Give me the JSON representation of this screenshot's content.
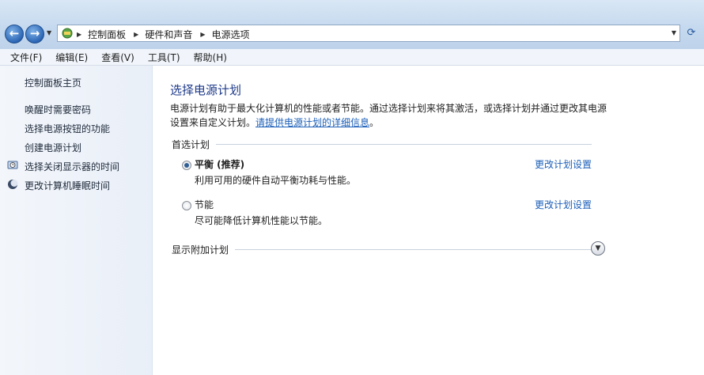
{
  "address": {
    "breadcrumbs": [
      "控制面板",
      "硬件和声音",
      "电源选项"
    ]
  },
  "menu": [
    "文件(F)",
    "编辑(E)",
    "查看(V)",
    "工具(T)",
    "帮助(H)"
  ],
  "sidebar": {
    "home": "控制面板主页",
    "links": [
      "唤醒时需要密码",
      "选择电源按钮的功能",
      "创建电源计划"
    ],
    "icon_links": [
      {
        "label": "选择关闭显示器的时间",
        "icon": "clock-icon"
      },
      {
        "label": "更改计算机睡眠时间",
        "icon": "moon-icon"
      }
    ]
  },
  "main": {
    "title": "选择电源计划",
    "description": "电源计划有助于最大化计算机的性能或者节能。通过选择计划来将其激活，或选择计划并通过更改其电源设置来自定义计划。",
    "description_link": "请提供电源计划的详细信息",
    "description_end": "。",
    "preferred_section": "首选计划",
    "plans": [
      {
        "name": "平衡 (推荐)",
        "description": "利用可用的硬件自动平衡功耗与性能。",
        "selected": true,
        "link": "更改计划设置"
      },
      {
        "name": "节能",
        "description": "尽可能降低计算机性能以节能。",
        "selected": false,
        "link": "更改计划设置"
      }
    ],
    "additional_section": "显示附加计划"
  },
  "colors": {
    "link": "#1c5fb8",
    "title": "#1e3a8a",
    "sidebar_bg": "#eef3fa"
  }
}
